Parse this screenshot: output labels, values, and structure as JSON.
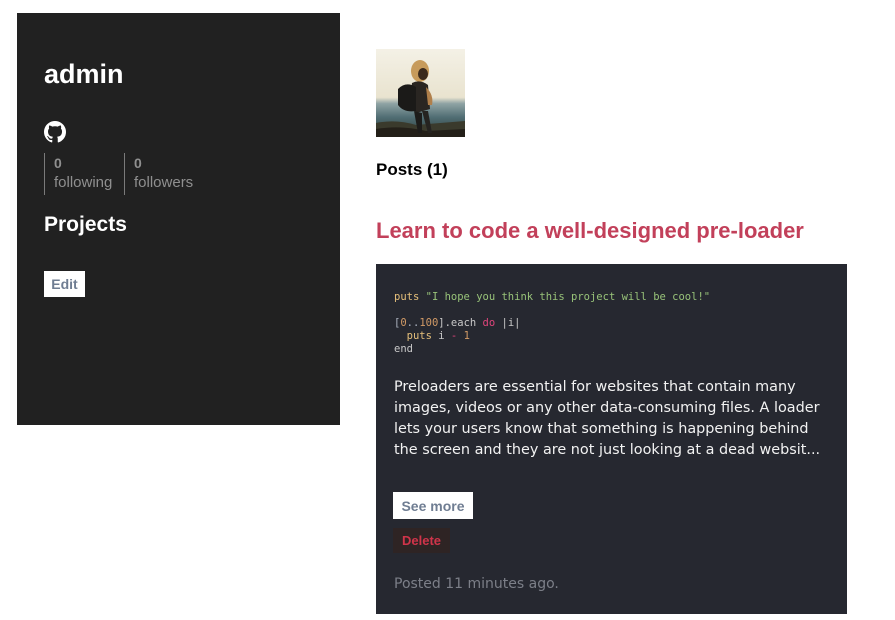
{
  "profile": {
    "username": "admin",
    "following_count": "0",
    "following_label": "following",
    "followers_count": "0",
    "followers_label": "followers",
    "projects_title": "Projects",
    "edit_label": "Edit",
    "social_icon": "github-icon"
  },
  "posts": {
    "heading": "Posts (1)",
    "items": [
      {
        "title": "Learn to code a well-designed pre-loader",
        "code": {
          "line1_method": "puts",
          "line1_string": "\"I hope you think this project will be cool!\"",
          "line2_open": "[",
          "line2_start": "0",
          "line2_range": "..",
          "line2_end": "100",
          "line2_close": "].each ",
          "line2_do": "do",
          "line2_block": " |i|",
          "line3_method": "puts",
          "line3_var": " i ",
          "line3_op": "-",
          "line3_num": "1",
          "line4_end": "end"
        },
        "excerpt": "Preloaders are essential for websites that contain many images, videos or any other data-consuming files. A loader lets your users know that something is happening behind the screen and they are not just looking at a dead websit...",
        "see_more_label": "See more",
        "delete_label": "Delete",
        "posted_text": "Posted 11 minutes ago."
      }
    ]
  },
  "colors": {
    "sidebar_bg": "#212121",
    "card_bg": "#262830",
    "title_accent": "#c2405a",
    "delete_text": "#d0344a"
  }
}
